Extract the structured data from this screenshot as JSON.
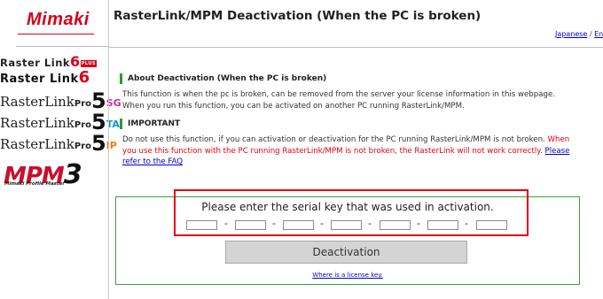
{
  "brand": {
    "logo": "Mimaki"
  },
  "header": {
    "title": "RasterLink/MPM Deactivation (When the PC is broken)",
    "lang_japanese": "Japanese",
    "lang_sep": "/",
    "lang_english": "English"
  },
  "products": [
    {
      "base": "Raster Link",
      "num": "6",
      "suffix": "PLUS"
    },
    {
      "base": "Raster Link",
      "num": "6",
      "suffix": ""
    },
    {
      "base": "RasterLink",
      "pro": "Pro",
      "num": "5",
      "suffix": "SG"
    },
    {
      "base": "RasterLink",
      "pro": "Pro",
      "num": "5",
      "suffix": "TA"
    },
    {
      "base": "RasterLink",
      "pro": "Pro",
      "num": "5",
      "suffix": "IP"
    },
    {
      "base": "MPM",
      "num": "3",
      "sub": "Mimaki Profile Master"
    }
  ],
  "section_about": {
    "heading": "About Deactivation (When the PC is broken)",
    "line1": "This function is when the pc is broken, can be removed from the server your license information in this webpage.",
    "line2": "When you run this function, you can be activated on another PC running RasterLink/MPM."
  },
  "section_important": {
    "heading": "IMPORTANT",
    "text_black": "Do not use this function, if you can activation or deactivation for the PC running RasterLink/MPM is not broken.",
    "text_red_1": "When",
    "text_red_2": "you use this function with the PC running RasterLink/MPM is not broken, the RasterLink will not work correctly.",
    "link_part1": "Please",
    "link_part2": "refer to the FAQ"
  },
  "form": {
    "prompt": "Please enter the serial key that was used in activation.",
    "serial_fields": [
      "",
      "",
      "",
      "",
      "",
      "",
      ""
    ],
    "dash": "-",
    "button_label": "Deactivation",
    "license_link": "Where is a license key."
  },
  "colors": {
    "brand_red": "#d6001c",
    "heading_green": "#2e9c2e",
    "highlight_red": "#e60012",
    "link_blue": "#0000cc"
  }
}
